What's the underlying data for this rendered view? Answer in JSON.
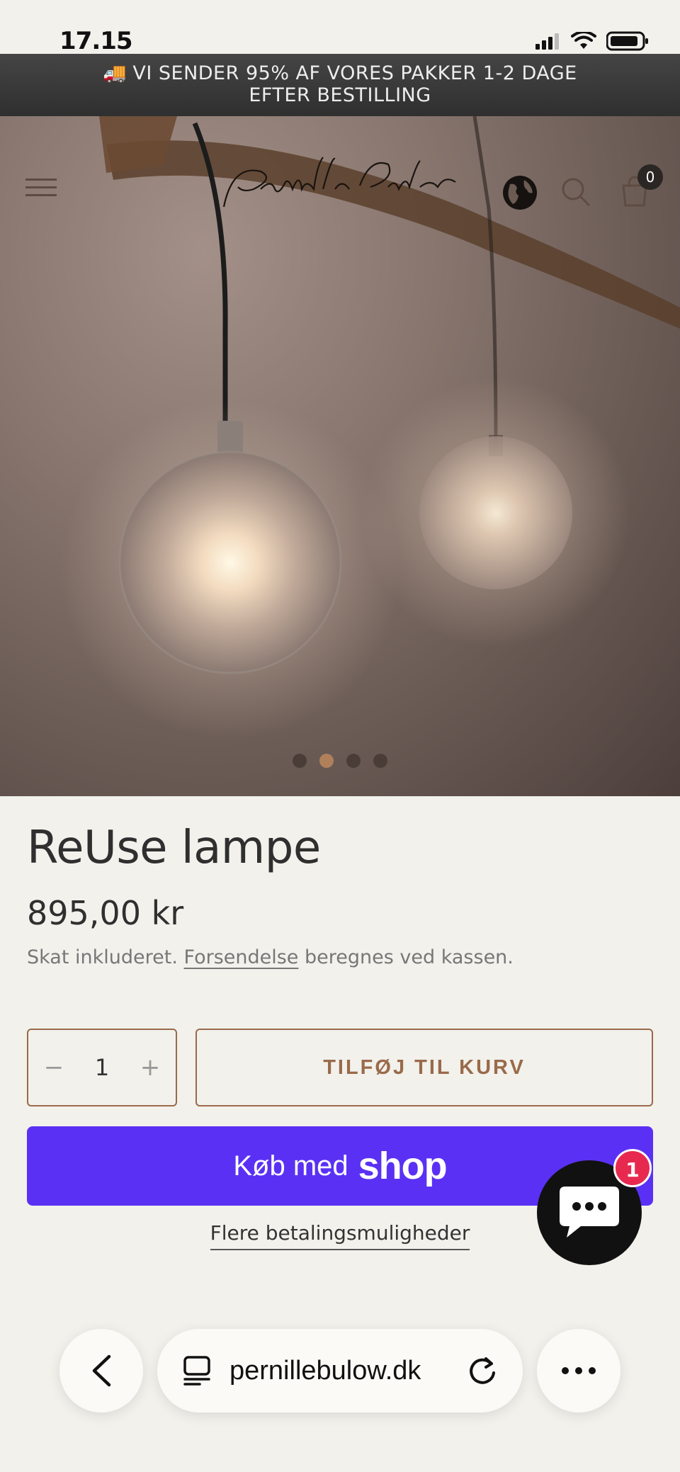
{
  "status": {
    "time": "17.15"
  },
  "announcement": {
    "line1": "VI SENDER 95% AF VORES PAKKER 1-2 DAGE",
    "line2": "EFTER BESTILLING",
    "icon": "truck-emoji"
  },
  "header": {
    "logo_text": "Pernille Bülow",
    "cart_count": "0"
  },
  "gallery": {
    "slides": 4,
    "active_index": 1
  },
  "product": {
    "title": "ReUse lampe",
    "price": "895,00 kr",
    "tax_prefix": "Skat inkluderet.",
    "shipping_link": "Forsendelse",
    "tax_suffix": "beregnes ved kassen."
  },
  "quantity": {
    "minus": "−",
    "value": "1",
    "plus": "+"
  },
  "buttons": {
    "add_to_cart": "TILFØJ TIL KURV",
    "shop_pay_label": "Køb med",
    "shop_pay_brand": "shop",
    "more_payment": "Flere betalingsmuligheder"
  },
  "chat": {
    "badge": "1"
  },
  "browser": {
    "url": "pernillebulow.dk"
  },
  "colors": {
    "accent": "#9a6a4a",
    "shop_pay": "#5a31f4",
    "chat_badge": "#e8294f"
  }
}
